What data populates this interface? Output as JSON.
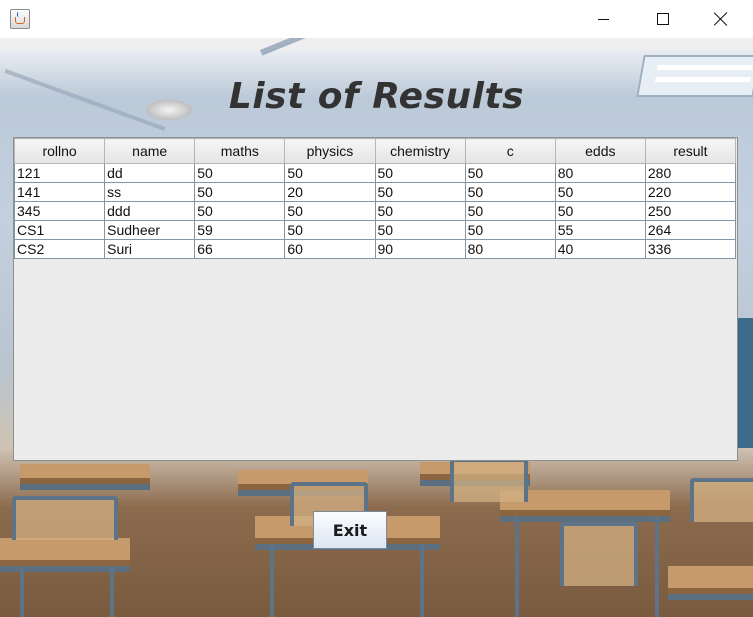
{
  "window": {
    "app_icon": "java-cup-icon",
    "minimize_icon": "minimize-icon",
    "maximize_icon": "maximize-icon",
    "close_icon": "close-icon"
  },
  "page": {
    "title": "List of Results",
    "exit_label": "Exit"
  },
  "table": {
    "columns": [
      "rollno",
      "name",
      "maths",
      "physics",
      "chemistry",
      "c",
      "edds",
      "result"
    ],
    "rows": [
      [
        "121",
        "dd",
        "50",
        "50",
        "50",
        "50",
        "80",
        "280"
      ],
      [
        "141",
        "ss",
        "50",
        "20",
        "50",
        "50",
        "50",
        "220"
      ],
      [
        "345",
        "ddd",
        "50",
        "50",
        "50",
        "50",
        "50",
        "250"
      ],
      [
        "CS1",
        "Sudheer",
        "59",
        "50",
        "50",
        "50",
        "55",
        "264"
      ],
      [
        "CS2",
        "Suri",
        "66",
        "60",
        "90",
        "80",
        "40",
        "336"
      ]
    ]
  },
  "colors": {
    "title_text": "#333333",
    "table_background": "#ececec",
    "grid_lines": "#8396a8"
  }
}
